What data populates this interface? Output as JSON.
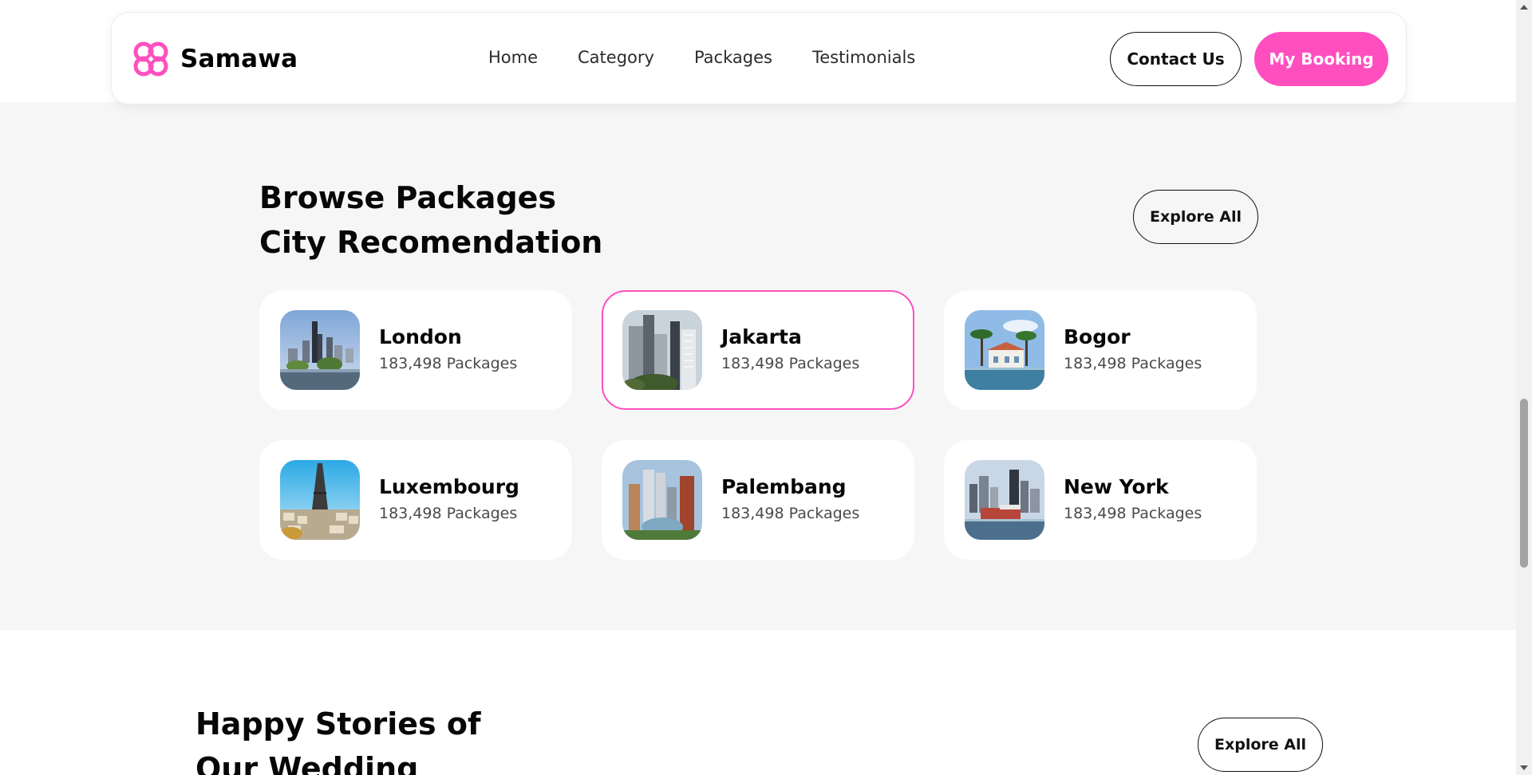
{
  "brand": {
    "name": "Samawa",
    "logo_icon": "quatrefoil-logo-icon",
    "accent_color": "#ff4fbf"
  },
  "nav": {
    "links": [
      {
        "label": "Home"
      },
      {
        "label": "Category"
      },
      {
        "label": "Packages"
      },
      {
        "label": "Testimonials"
      }
    ],
    "contact_label": "Contact Us",
    "booking_label": "My Booking"
  },
  "browse": {
    "title_line1": "Browse Packages",
    "title_line2": "City Recomendation",
    "explore_label": "Explore All",
    "cities": [
      {
        "name": "London",
        "count": "183,498 Packages",
        "image": "city-skyline-icon",
        "active": false
      },
      {
        "name": "Jakarta",
        "count": "183,498 Packages",
        "image": "skyscrapers-icon",
        "active": true
      },
      {
        "name": "Bogor",
        "count": "183,498 Packages",
        "image": "palm-villa-icon",
        "active": false
      },
      {
        "name": "Luxembourg",
        "count": "183,498 Packages",
        "image": "eiffel-tower-icon",
        "active": false
      },
      {
        "name": "Palembang",
        "count": "183,498 Packages",
        "image": "modern-towers-icon",
        "active": false
      },
      {
        "name": "New York",
        "count": "183,498 Packages",
        "image": "harbor-skyline-icon",
        "active": false
      }
    ]
  },
  "stories": {
    "title_line1": "Happy Stories of",
    "title_line2": "Our Wedding",
    "explore_label": "Explore All"
  }
}
